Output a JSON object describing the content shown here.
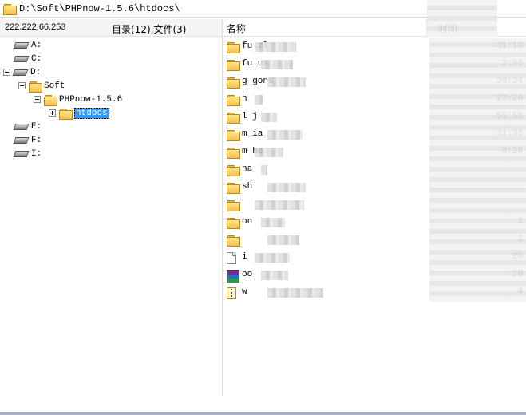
{
  "path_bar": {
    "path": "D:\\Soft\\PHPnow-1.5.6\\htdocs\\"
  },
  "info": {
    "ip": "222.222.66.253",
    "counts": "目录(12),文件(3)"
  },
  "tree": {
    "drive_a": "A:",
    "drive_c": "C:",
    "drive_d": "D:",
    "folder_soft": "Soft",
    "folder_phpnow": "PHPnow-1.5.6",
    "folder_htdocs": "htdocs",
    "drive_e": "E:",
    "drive_f": "F:",
    "drive_i": "I:"
  },
  "list": {
    "header_name": "名称",
    "header_time": "时间",
    "rows": [
      {
        "name": "fu  zl",
        "time": "31:10",
        "icon": "folder-icon"
      },
      {
        "name": "fu  us",
        "time": "3:06",
        "icon": "folder-icon"
      },
      {
        "name": "g   gons",
        "time": "36:34",
        "icon": "folder-icon"
      },
      {
        "name": "h",
        "time": "22:20",
        "icon": "folder-icon"
      },
      {
        "name": "l   j",
        "time": "55:58",
        "icon": "folder-icon"
      },
      {
        "name": "m   ia",
        "time": "31:38",
        "icon": "folder-icon"
      },
      {
        "name": "m   he",
        "time": "0:29",
        "icon": "folder-icon"
      },
      {
        "name": "na",
        "time": "",
        "icon": "folder-icon"
      },
      {
        "name": "sh",
        "time": "",
        "icon": "folder-icon"
      },
      {
        "name": "",
        "time": "",
        "icon": "folder-icon"
      },
      {
        "name": "         on",
        "time": "2",
        "icon": "folder-icon"
      },
      {
        "name": "",
        "time": "2",
        "icon": "folder-icon"
      },
      {
        "name": "i",
        "time": "20",
        "icon": "document-icon"
      },
      {
        "name": "oo",
        "time": "20",
        "icon": "rar-archive-icon"
      },
      {
        "name": "w",
        "time": "4",
        "icon": "zip-archive-icon"
      }
    ]
  }
}
